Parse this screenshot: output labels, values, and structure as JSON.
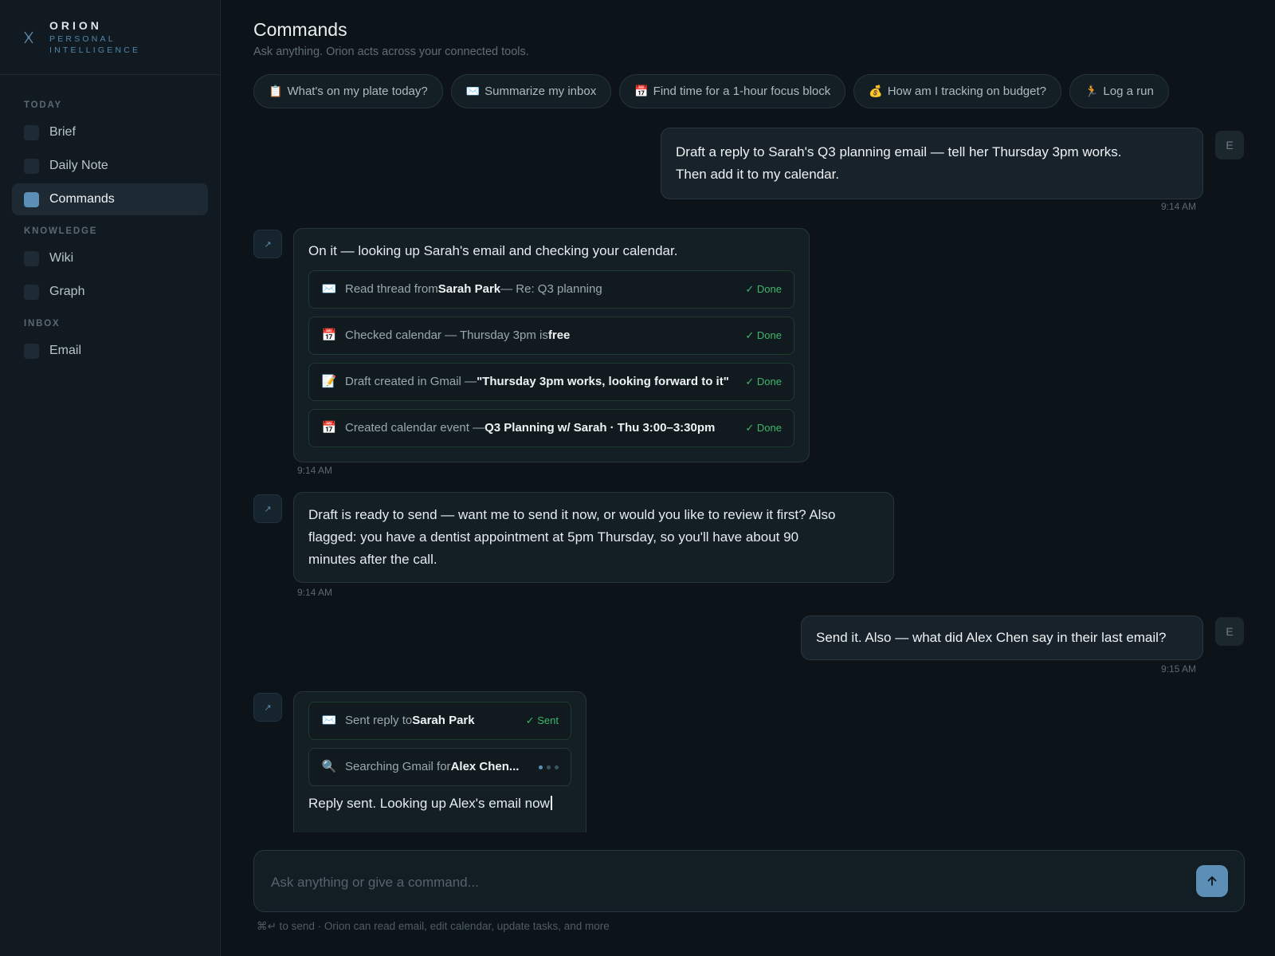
{
  "brand": {
    "name": "ORION",
    "sub1": "PERSONAL",
    "sub2": "INTELLIGENCE"
  },
  "sidebar": {
    "sections": [
      {
        "title": "TODAY",
        "items": [
          {
            "label": "Brief"
          },
          {
            "label": "Daily Note"
          },
          {
            "label": "Commands",
            "active": true
          }
        ]
      },
      {
        "title": "KNOWLEDGE",
        "items": [
          {
            "label": "Wiki"
          },
          {
            "label": "Graph"
          }
        ]
      },
      {
        "title": "INBOX",
        "items": [
          {
            "label": "Email"
          }
        ]
      }
    ]
  },
  "header": {
    "title": "Commands",
    "subtitle": "Ask anything. Orion acts across your connected tools."
  },
  "chips": [
    {
      "icon": "📋",
      "label": "What's on my plate today?"
    },
    {
      "icon": "✉️",
      "label": "Summarize my inbox"
    },
    {
      "icon": "📅",
      "label": "Find time for a 1-hour focus block"
    },
    {
      "icon": "💰",
      "label": "How am I tracking on budget?"
    },
    {
      "icon": "🏃",
      "label": "Log a run"
    }
  ],
  "conversation": {
    "user_initial": "E",
    "m1": {
      "text_line1": "Draft a reply to Sarah's Q3 planning email — tell her Thursday 3pm works.",
      "text_line2": "Then add it to my calendar.",
      "time": "9:14 AM"
    },
    "m2": {
      "text": "On it — looking up Sarah's email and checking your calendar.",
      "time": "9:14 AM",
      "steps": [
        {
          "icon": "✉️",
          "pre": "Read thread from ",
          "bold": "Sarah Park",
          "post": " — Re: Q3 planning",
          "status": "✓ Done"
        },
        {
          "icon": "📅",
          "pre": "Checked calendar — Thursday 3pm is ",
          "bold": "free",
          "post": "",
          "status": "✓ Done"
        },
        {
          "icon": "📝",
          "pre": "Draft created in Gmail — ",
          "bold": "\"Thursday 3pm works, looking forward to it\"",
          "post": "",
          "status": "✓ Done"
        },
        {
          "icon": "📅",
          "pre": "Created calendar event — ",
          "bold": "Q3 Planning w/ Sarah · Thu 3:00–3:30pm",
          "post": "",
          "status": "✓ Done"
        }
      ]
    },
    "m3": {
      "line1": "Draft is ready to send — want me to send it now, or would you like to review it first? Also",
      "line2": "flagged: you have a dentist appointment at 5pm Thursday, so you'll have about 90",
      "line3": "minutes after the call.",
      "time": "9:14 AM"
    },
    "m4": {
      "text": "Send it. Also — what did Alex Chen say in their last email?",
      "time": "9:15 AM"
    },
    "m5": {
      "steps": [
        {
          "icon": "✉️",
          "pre": "Sent reply to ",
          "bold": "Sarah Park",
          "status": "✓ Sent"
        },
        {
          "icon": "🔍",
          "pre": "Searching Gmail for ",
          "bold": "Alex Chen..."
        }
      ],
      "text": "Reply sent. Looking up Alex's email now"
    }
  },
  "composer": {
    "placeholder": "Ask anything or give a command...",
    "hint": "⌘↵ to send · Orion can read email, edit calendar, update tasks, and more"
  },
  "colors": {
    "accent": "#5b8fb5",
    "success": "#3fb56a",
    "background": "#0c1419"
  }
}
